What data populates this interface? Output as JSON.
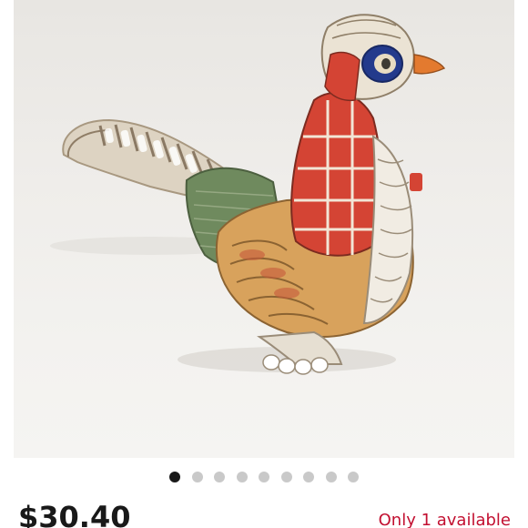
{
  "listing": {
    "image_subject": "ceramic-pheasant-figurine",
    "carousel": {
      "total_images": 9,
      "active_index": 0
    },
    "price": "$30.40",
    "availability": "Only 1 available"
  },
  "colors": {
    "price_text": "#191919",
    "availability_text": "#c20f30",
    "dot_active": "#191919",
    "dot_inactive": "#c9c9c9"
  }
}
